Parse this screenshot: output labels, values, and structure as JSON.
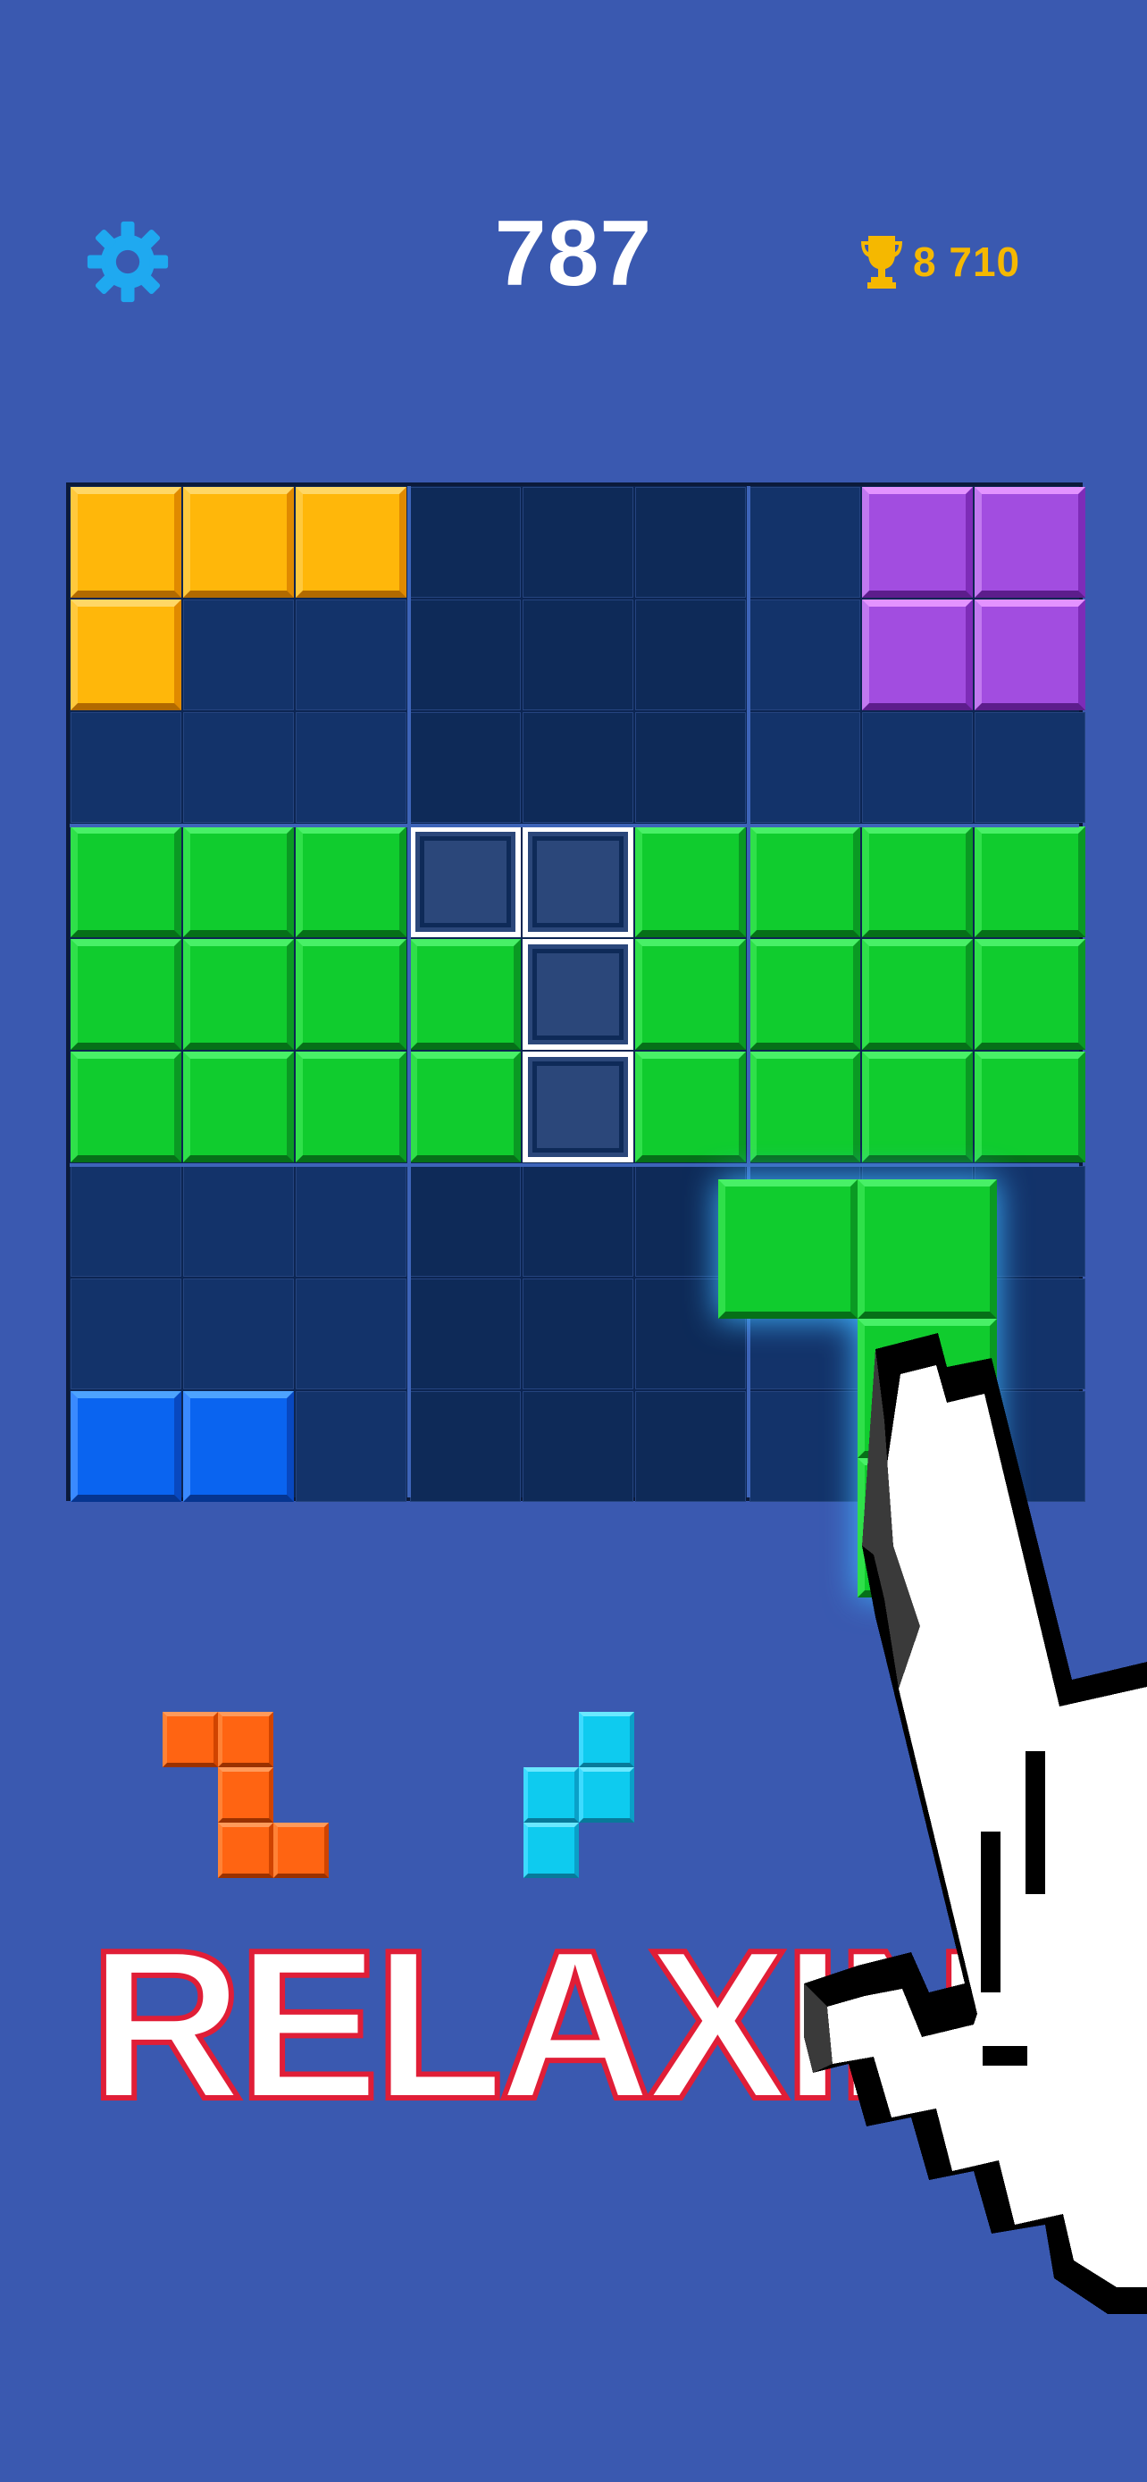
{
  "header": {
    "settings_icon": "gear-icon",
    "score": "787",
    "best_icon": "trophy-icon",
    "best_score": "8 710"
  },
  "board": {
    "rows": 9,
    "cols": 9,
    "cells": [
      [
        "yellow",
        "yellow",
        "yellow",
        "",
        "",
        "",
        "",
        "purple",
        "purple"
      ],
      [
        "yellow",
        "",
        "",
        "",
        "",
        "",
        "",
        "purple",
        "purple"
      ],
      [
        "",
        "",
        "",
        "",
        "",
        "",
        "",
        "",
        ""
      ],
      [
        "green",
        "green",
        "green",
        "ghost",
        "ghost",
        "green",
        "green",
        "green",
        "green"
      ],
      [
        "green",
        "green",
        "green",
        "green",
        "ghost",
        "green",
        "green",
        "green",
        "green"
      ],
      [
        "green",
        "green",
        "green",
        "green",
        "ghost",
        "green",
        "green",
        "green",
        "green"
      ],
      [
        "",
        "",
        "",
        "",
        "",
        "",
        "",
        "",
        ""
      ],
      [
        "",
        "",
        "",
        "",
        "",
        "",
        "",
        "",
        ""
      ],
      [
        "blue",
        "blue",
        "",
        "",
        "",
        "",
        "",
        "",
        ""
      ]
    ]
  },
  "dragging_piece": {
    "color": "green",
    "shape": [
      [
        1,
        1
      ],
      [
        0,
        1
      ],
      [
        0,
        1
      ]
    ]
  },
  "tray": [
    {
      "color": "orange",
      "shape": [
        [
          1,
          1,
          0
        ],
        [
          0,
          1,
          0
        ],
        [
          0,
          1,
          1
        ]
      ]
    },
    {
      "color": "cyan",
      "shape": [
        [
          0,
          1
        ],
        [
          1,
          1
        ],
        [
          1,
          0
        ]
      ]
    }
  ],
  "banner": {
    "text": "RELAXING"
  },
  "colors": {
    "background": "#3a59b0",
    "score_text": "#ffffff",
    "best_score_text": "#f5b800",
    "settings_icon": "#1fa9f0",
    "banner_outline": "#e01e37"
  }
}
